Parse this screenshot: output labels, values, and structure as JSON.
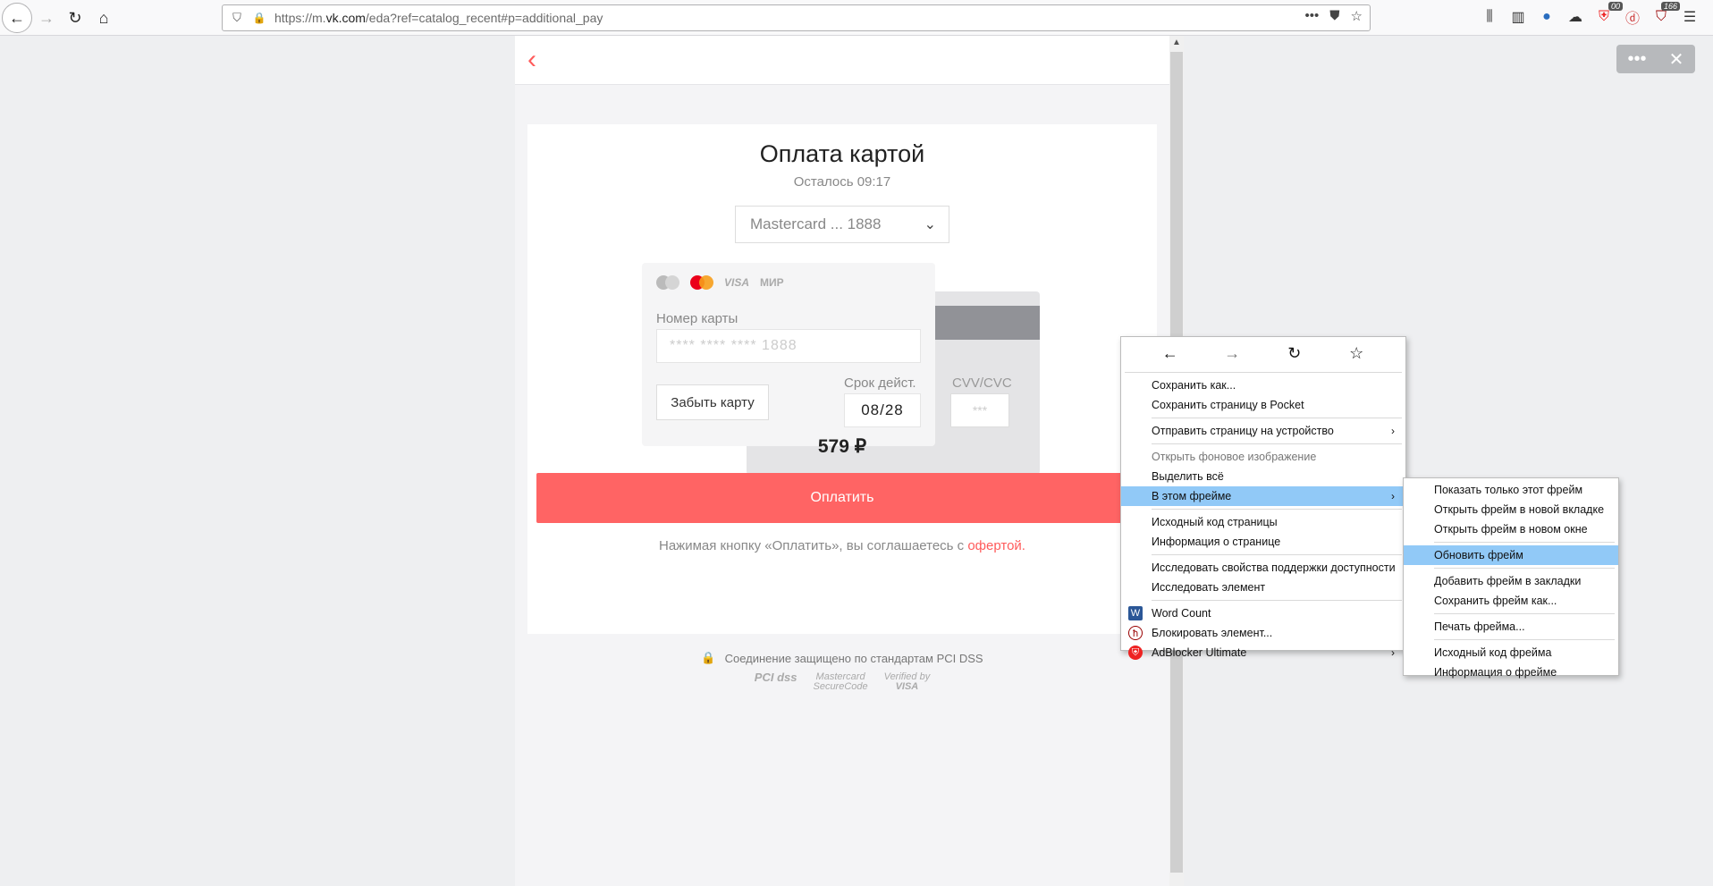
{
  "browser": {
    "url_prefix": "https://m.",
    "url_domain": "vk.com",
    "url_rest": "/eda?ref=catalog_recent#p=additional_pay",
    "extension_badge": "166",
    "small_badge": "00"
  },
  "payment": {
    "title": "Оплата картой",
    "timer": "Осталось 09:17",
    "selected_card": "Mastercard ... 1888",
    "card_brands": [
      "VISA",
      "МИР"
    ],
    "card_number_label": "Номер карты",
    "card_number_value": "**** **** **** 1888",
    "expiry_label": "Срок дейст.",
    "expiry_value": "08/28",
    "cvv_label": "CVV/CVC",
    "cvv_placeholder": "***",
    "forget_button": "Забыть карту",
    "amount": "579 ₽",
    "pay_button": "Оплатить",
    "agree_text": "Нажимая кнопку «Оплатить», вы соглашаетесь с ",
    "agree_link": "офертой.",
    "secure_text": "Соединение защищено по стандартам PCI DSS",
    "logo_pci": "PCI dss",
    "logo_mc_line1": "Mastercard",
    "logo_mc_line2": "SecureCode",
    "logo_visa_line1": "Verified by",
    "logo_visa_line2": "VISA"
  },
  "context_menu": {
    "items": [
      "Сохранить как...",
      "Сохранить страницу в Pocket",
      "Отправить страницу на устройство",
      "Открыть фоновое изображение",
      "Выделить всё",
      "В этом фрейме",
      "Исходный код страницы",
      "Информация о странице",
      "Исследовать свойства поддержки доступности",
      "Исследовать элемент",
      "Word Count",
      "Блокировать элемент...",
      "AdBlocker Ultimate"
    ]
  },
  "frame_submenu": {
    "items": [
      "Показать только этот фрейм",
      "Открыть фрейм в новой вкладке",
      "Открыть фрейм в новом окне",
      "Обновить фрейм",
      "Добавить фрейм в закладки",
      "Сохранить фрейм как...",
      "Печать фрейма...",
      "Исходный код фрейма",
      "Информация о фрейме"
    ]
  },
  "colors": {
    "accent": "#ff6464",
    "highlight": "#91c9f7"
  }
}
